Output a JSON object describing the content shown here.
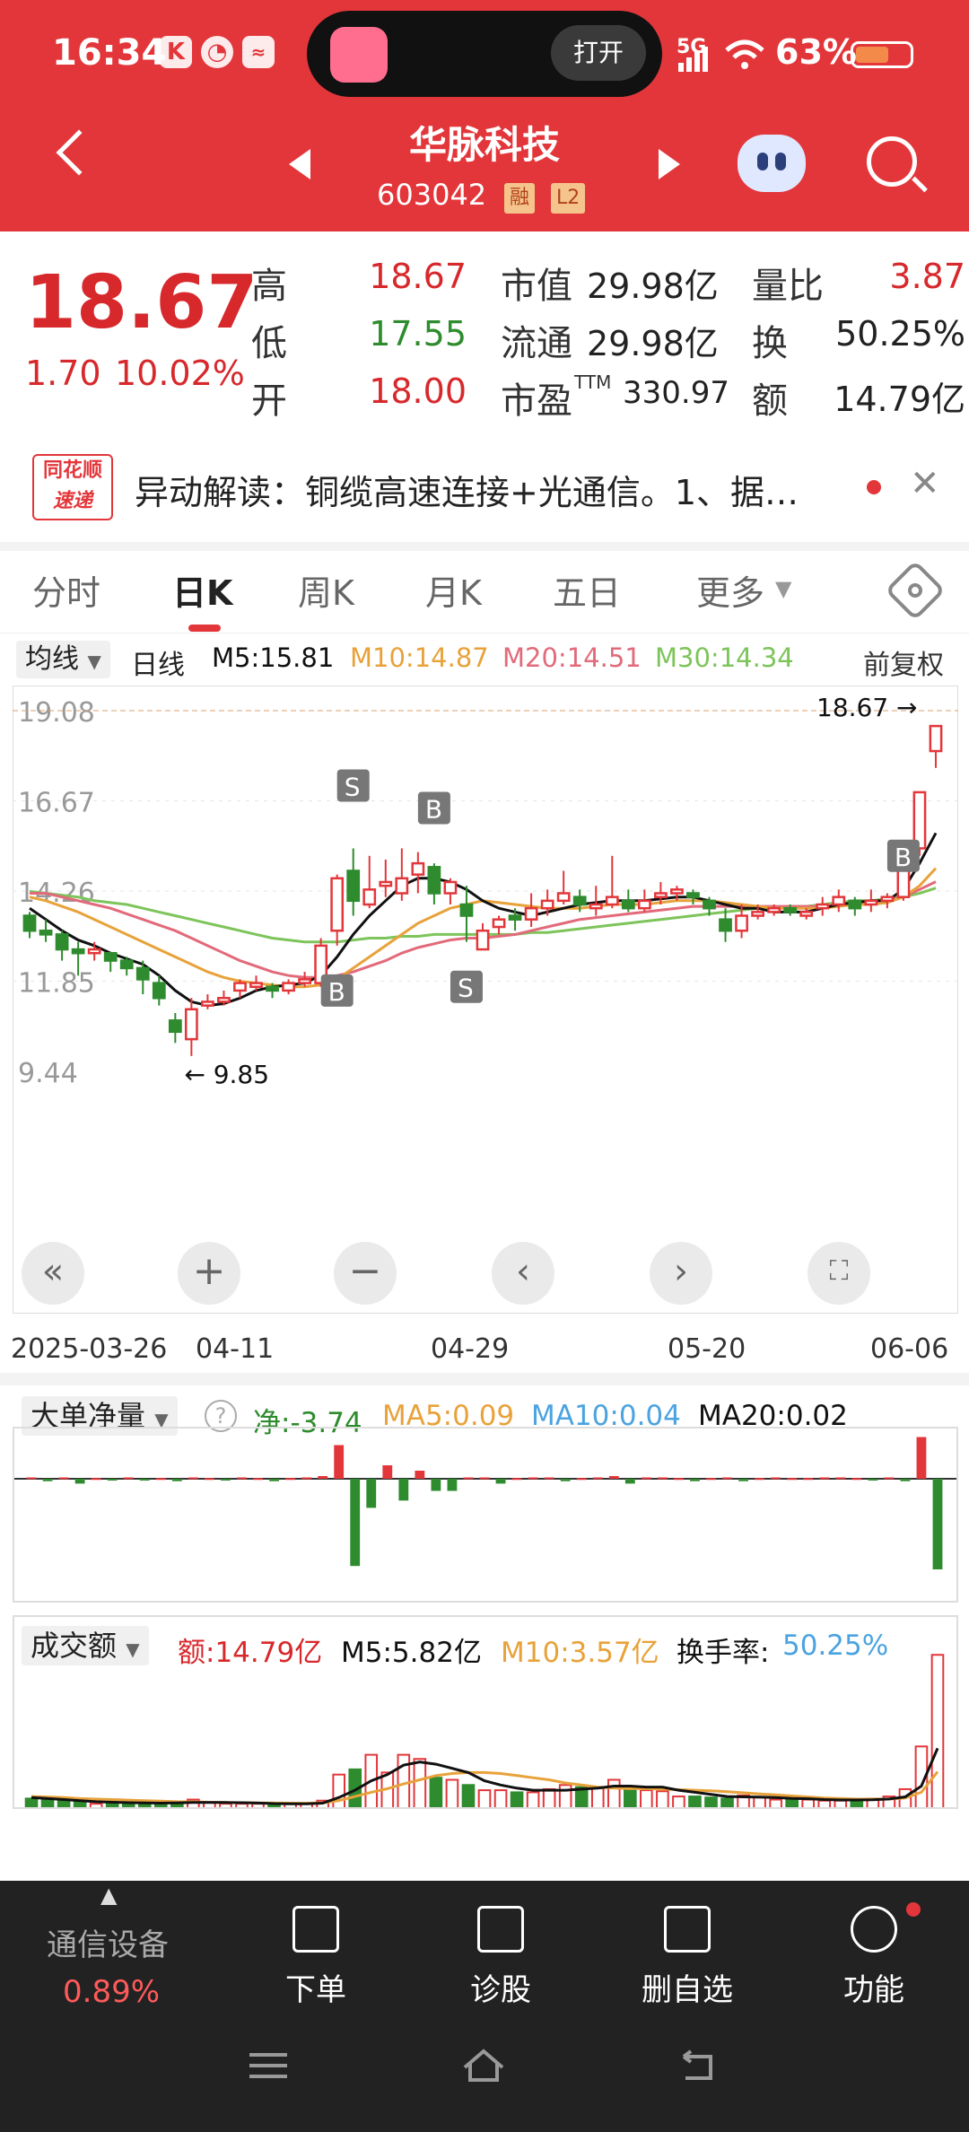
{
  "status_bar": {
    "time": "16:34",
    "battery": "63%",
    "network": "5G",
    "island_button": "打开"
  },
  "header": {
    "stock_name": "华脉科技",
    "stock_code": "603042",
    "tags": [
      "融",
      "L2"
    ]
  },
  "quote": {
    "price": "18.67",
    "change": "1.70",
    "change_pct": "10.02%",
    "high_label": "高",
    "high": "18.67",
    "low_label": "低",
    "low": "17.55",
    "open_label": "开",
    "open": "18.00",
    "mktcap_label": "市值",
    "mktcap": "29.98亿",
    "float_label": "流通",
    "float": "29.98亿",
    "pe_label": "市盈",
    "pe_sup": "TTM",
    "pe": "330.97",
    "vol_ratio_label": "量比",
    "vol_ratio": "3.87",
    "turnover_label": "换",
    "turnover": "50.25%",
    "amount_label": "额",
    "amount": "14.79亿"
  },
  "news": {
    "logo_top": "同花顺",
    "logo_bottom": "速递",
    "text": "异动解读：铜缆高速连接+光通信。1、据…"
  },
  "tabs": [
    "分时",
    "日K",
    "周K",
    "月K",
    "五日",
    "更多"
  ],
  "ma_row": {
    "selector": "均线",
    "period": "日线",
    "m5": "M5:15.81",
    "m10": "M10:14.87",
    "m20": "M20:14.51",
    "m30": "M30:14.34",
    "adjust": "前复权"
  },
  "chart_markers": {
    "current_price": "18.67",
    "low_price": "9.85",
    "signal_sell": "S",
    "signal_buy": "B"
  },
  "dates": [
    "2025-03-26",
    "04-11",
    "04-29",
    "05-20",
    "06-06"
  ],
  "flow_panel": {
    "selector": "大单净量",
    "help": "?",
    "net": "净:-3.74",
    "ma5": "MA5:0.09",
    "ma10": "MA10:0.04",
    "ma20": "MA20:0.02"
  },
  "vol_panel": {
    "selector": "成交额",
    "amount": "额:14.79亿",
    "m5": "M5:5.82亿",
    "m10": "M10:3.57亿",
    "turn_label": "换手率:",
    "turn": "50.25%"
  },
  "bottom_bar": {
    "sector_name": "通信设备",
    "sector_change": "0.89%",
    "items": [
      "下单",
      "诊股",
      "删自选",
      "功能"
    ]
  },
  "colors": {
    "up": "#e3363a",
    "down": "#2e8b2e",
    "ma5": "#111111",
    "ma10": "#e8a23a",
    "ma20": "#e26a7a",
    "ma30": "#7dc45a",
    "accent": "#e3363a"
  },
  "chart_data": {
    "type": "candlestick",
    "y_ticks": [
      "19.08",
      "16.67",
      "14.26",
      "11.85",
      "9.44"
    ],
    "ylim": [
      9.44,
      19.08
    ],
    "candles": [
      [
        13.6,
        13.2,
        13.7,
        13.0
      ],
      [
        13.2,
        13.1,
        13.5,
        12.9
      ],
      [
        13.1,
        12.7,
        13.2,
        12.4
      ],
      [
        12.7,
        12.6,
        12.9,
        12.0
      ],
      [
        12.6,
        12.7,
        12.9,
        12.4
      ],
      [
        12.6,
        12.4,
        12.6,
        12.1
      ],
      [
        12.4,
        12.2,
        12.5,
        12.0
      ],
      [
        12.2,
        11.9,
        12.4,
        11.5
      ],
      [
        11.8,
        11.4,
        12.0,
        11.2
      ],
      [
        10.8,
        10.5,
        11.0,
        10.2
      ],
      [
        10.3,
        11.1,
        11.4,
        9.85
      ],
      [
        11.2,
        11.3,
        11.5,
        11.1
      ],
      [
        11.3,
        11.4,
        11.6,
        11.2
      ],
      [
        11.6,
        11.8,
        11.9,
        11.4
      ],
      [
        11.7,
        11.8,
        12.0,
        11.6
      ],
      [
        11.7,
        11.6,
        11.8,
        11.4
      ],
      [
        11.6,
        11.8,
        11.9,
        11.5
      ],
      [
        11.8,
        11.9,
        12.1,
        11.7
      ],
      [
        11.8,
        12.8,
        13.0,
        11.7
      ],
      [
        13.2,
        14.6,
        14.7,
        12.8
      ],
      [
        14.8,
        14.0,
        15.4,
        13.6
      ],
      [
        13.9,
        14.3,
        15.2,
        13.8
      ],
      [
        14.4,
        14.5,
        15.1,
        14.1
      ],
      [
        14.2,
        14.6,
        15.4,
        14.0
      ],
      [
        14.7,
        15.0,
        15.3,
        14.2
      ],
      [
        14.9,
        14.2,
        15.0,
        13.9
      ],
      [
        14.2,
        14.5,
        14.6,
        13.9
      ],
      [
        13.9,
        13.6,
        14.4,
        12.9
      ],
      [
        12.7,
        13.2,
        13.4,
        12.7
      ],
      [
        13.3,
        13.5,
        13.6,
        13.1
      ],
      [
        13.6,
        13.5,
        13.8,
        13.2
      ],
      [
        13.5,
        13.8,
        14.2,
        13.3
      ],
      [
        13.8,
        14.0,
        14.3,
        13.6
      ],
      [
        14.0,
        14.2,
        14.8,
        13.9
      ],
      [
        14.1,
        13.9,
        14.3,
        13.7
      ],
      [
        13.8,
        13.9,
        14.4,
        13.6
      ],
      [
        13.9,
        14.1,
        15.2,
        13.8
      ],
      [
        14.0,
        13.8,
        14.3,
        13.7
      ],
      [
        13.8,
        14.0,
        14.3,
        13.7
      ],
      [
        14.1,
        14.2,
        14.5,
        13.9
      ],
      [
        14.2,
        14.3,
        14.4,
        14.0
      ],
      [
        14.2,
        14.1,
        14.3,
        13.9
      ],
      [
        14.0,
        13.8,
        14.1,
        13.6
      ],
      [
        13.5,
        13.2,
        13.8,
        12.9
      ],
      [
        13.2,
        13.6,
        13.9,
        13.0
      ],
      [
        13.6,
        13.7,
        13.9,
        13.5
      ],
      [
        13.7,
        13.8,
        13.9,
        13.6
      ],
      [
        13.8,
        13.7,
        13.9,
        13.6
      ],
      [
        13.6,
        13.7,
        13.8,
        13.5
      ],
      [
        13.8,
        13.9,
        14.1,
        13.6
      ],
      [
        13.9,
        14.1,
        14.3,
        13.7
      ],
      [
        14.0,
        13.8,
        14.1,
        13.6
      ],
      [
        13.9,
        14.0,
        14.3,
        13.7
      ],
      [
        14.0,
        14.1,
        14.2,
        13.8
      ],
      [
        14.1,
        15.2,
        15.6,
        14.0
      ],
      [
        15.4,
        16.9,
        16.9,
        15.2
      ],
      [
        18.0,
        18.67,
        18.67,
        17.55
      ]
    ],
    "ma5": [
      13.8,
      13.5,
      13.2,
      12.95,
      12.8,
      12.6,
      12.45,
      12.3,
      12.0,
      11.6,
      11.3,
      11.2,
      11.25,
      11.4,
      11.6,
      11.7,
      11.75,
      11.8,
      12.0,
      12.5,
      13.1,
      13.6,
      14.0,
      14.4,
      14.6,
      14.6,
      14.5,
      14.3,
      14.0,
      13.8,
      13.7,
      13.6,
      13.7,
      13.8,
      13.9,
      13.95,
      14.0,
      14.0,
      14.0,
      14.05,
      14.1,
      14.1,
      14.0,
      13.9,
      13.8,
      13.8,
      13.7,
      13.7,
      13.7,
      13.8,
      13.9,
      13.95,
      14.0,
      14.0,
      14.3,
      15.0,
      15.81
    ],
    "ma10": [
      14.1,
      14.0,
      13.85,
      13.7,
      13.5,
      13.3,
      13.1,
      12.9,
      12.7,
      12.5,
      12.3,
      12.1,
      11.95,
      11.85,
      11.8,
      11.75,
      11.7,
      11.7,
      11.75,
      11.9,
      12.2,
      12.5,
      12.8,
      13.1,
      13.4,
      13.6,
      13.8,
      13.9,
      14.0,
      13.95,
      13.9,
      13.85,
      13.8,
      13.8,
      13.8,
      13.85,
      13.9,
      13.9,
      13.9,
      13.95,
      14.0,
      14.0,
      14.0,
      13.95,
      13.9,
      13.85,
      13.8,
      13.8,
      13.8,
      13.8,
      13.85,
      13.9,
      13.9,
      13.95,
      14.1,
      14.4,
      14.87
    ],
    "ma20": [
      14.2,
      14.2,
      14.1,
      14.0,
      13.9,
      13.8,
      13.65,
      13.5,
      13.35,
      13.2,
      13.0,
      12.8,
      12.6,
      12.4,
      12.25,
      12.1,
      12.0,
      11.95,
      11.95,
      12.0,
      12.1,
      12.25,
      12.4,
      12.6,
      12.75,
      12.85,
      12.95,
      13.0,
      13.0,
      13.05,
      13.1,
      13.2,
      13.3,
      13.4,
      13.5,
      13.55,
      13.6,
      13.65,
      13.7,
      13.75,
      13.8,
      13.85,
      13.85,
      13.85,
      13.85,
      13.85,
      13.85,
      13.85,
      13.85,
      13.85,
      13.9,
      13.9,
      13.95,
      14.0,
      14.1,
      14.3,
      14.51
    ],
    "ma30": [
      14.25,
      14.2,
      14.15,
      14.1,
      14.0,
      13.95,
      13.9,
      13.8,
      13.7,
      13.6,
      13.5,
      13.4,
      13.3,
      13.2,
      13.1,
      13.0,
      12.95,
      12.9,
      12.9,
      12.9,
      12.95,
      13.0,
      13.0,
      13.05,
      13.05,
      13.1,
      13.1,
      13.1,
      13.1,
      13.1,
      13.1,
      13.15,
      13.15,
      13.2,
      13.25,
      13.3,
      13.35,
      13.4,
      13.45,
      13.5,
      13.55,
      13.6,
      13.65,
      13.7,
      13.75,
      13.8,
      13.8,
      13.85,
      13.85,
      13.9,
      13.95,
      14.0,
      14.0,
      14.05,
      14.1,
      14.2,
      14.34
    ],
    "flow": [
      0.1,
      -0.1,
      0.1,
      -0.2,
      0.05,
      -0.05,
      0.1,
      -0.05,
      0.05,
      -0.1,
      0.1,
      0.05,
      -0.05,
      0.1,
      0.05,
      -0.1,
      0.05,
      0.1,
      0.2,
      2.5,
      -3.6,
      -1.2,
      1.0,
      -0.9,
      0.6,
      -0.5,
      -0.5,
      0.1,
      0.1,
      -0.2,
      0.05,
      0.1,
      0.1,
      -0.1,
      0.05,
      0.1,
      0.2,
      -0.2,
      0.1,
      0.1,
      0.05,
      -0.1,
      0.05,
      0.1,
      -0.1,
      0.05,
      0.1,
      0.05,
      0.05,
      0.1,
      0.1,
      0.05,
      -0.05,
      0.1,
      -0.1,
      3.1,
      -3.74
    ],
    "turnover_amount": [
      1.0,
      0.9,
      0.8,
      0.7,
      0.5,
      0.6,
      0.5,
      0.6,
      0.5,
      0.7,
      0.9,
      0.6,
      0.5,
      0.5,
      0.5,
      0.4,
      0.5,
      0.5,
      0.8,
      3.3,
      3.8,
      5.2,
      3.5,
      5.2,
      4.8,
      3.0,
      2.8,
      2.3,
      1.8,
      1.8,
      1.6,
      1.6,
      1.9,
      2.3,
      2.1,
      2.0,
      2.8,
      2.0,
      1.8,
      1.7,
      1.2,
      1.2,
      1.1,
      1.0,
      1.3,
      1.1,
      0.9,
      0.9,
      0.9,
      0.8,
      0.8,
      0.9,
      1.0,
      1.2,
      1.9,
      6.0,
      14.79
    ],
    "vol_ma5": [
      1.1,
      1.0,
      0.9,
      0.8,
      0.7,
      0.65,
      0.6,
      0.58,
      0.56,
      0.58,
      0.62,
      0.62,
      0.62,
      0.6,
      0.57,
      0.52,
      0.5,
      0.5,
      0.56,
      1.1,
      1.8,
      2.7,
      3.3,
      4.2,
      4.5,
      4.3,
      3.9,
      3.5,
      2.7,
      2.3,
      2.0,
      1.8,
      1.8,
      1.8,
      1.9,
      2.0,
      2.2,
      2.2,
      2.1,
      2.1,
      1.8,
      1.6,
      1.4,
      1.2,
      1.16,
      1.14,
      1.1,
      1.02,
      0.98,
      0.9,
      0.86,
      0.86,
      0.88,
      0.96,
      1.16,
      2.2,
      5.82
    ],
    "vol_ma10": [
      1.2,
      1.15,
      1.1,
      1.0,
      0.95,
      0.9,
      0.85,
      0.8,
      0.75,
      0.7,
      0.68,
      0.65,
      0.62,
      0.6,
      0.58,
      0.57,
      0.56,
      0.55,
      0.58,
      0.8,
      1.2,
      1.6,
      1.95,
      2.4,
      2.8,
      3.2,
      3.4,
      3.5,
      3.5,
      3.4,
      3.2,
      3.0,
      2.8,
      2.5,
      2.3,
      2.1,
      2.0,
      1.95,
      1.95,
      1.9,
      1.85,
      1.8,
      1.75,
      1.65,
      1.55,
      1.45,
      1.35,
      1.25,
      1.15,
      1.05,
      1.0,
      0.95,
      0.95,
      0.95,
      1.05,
      1.6,
      3.57
    ]
  }
}
